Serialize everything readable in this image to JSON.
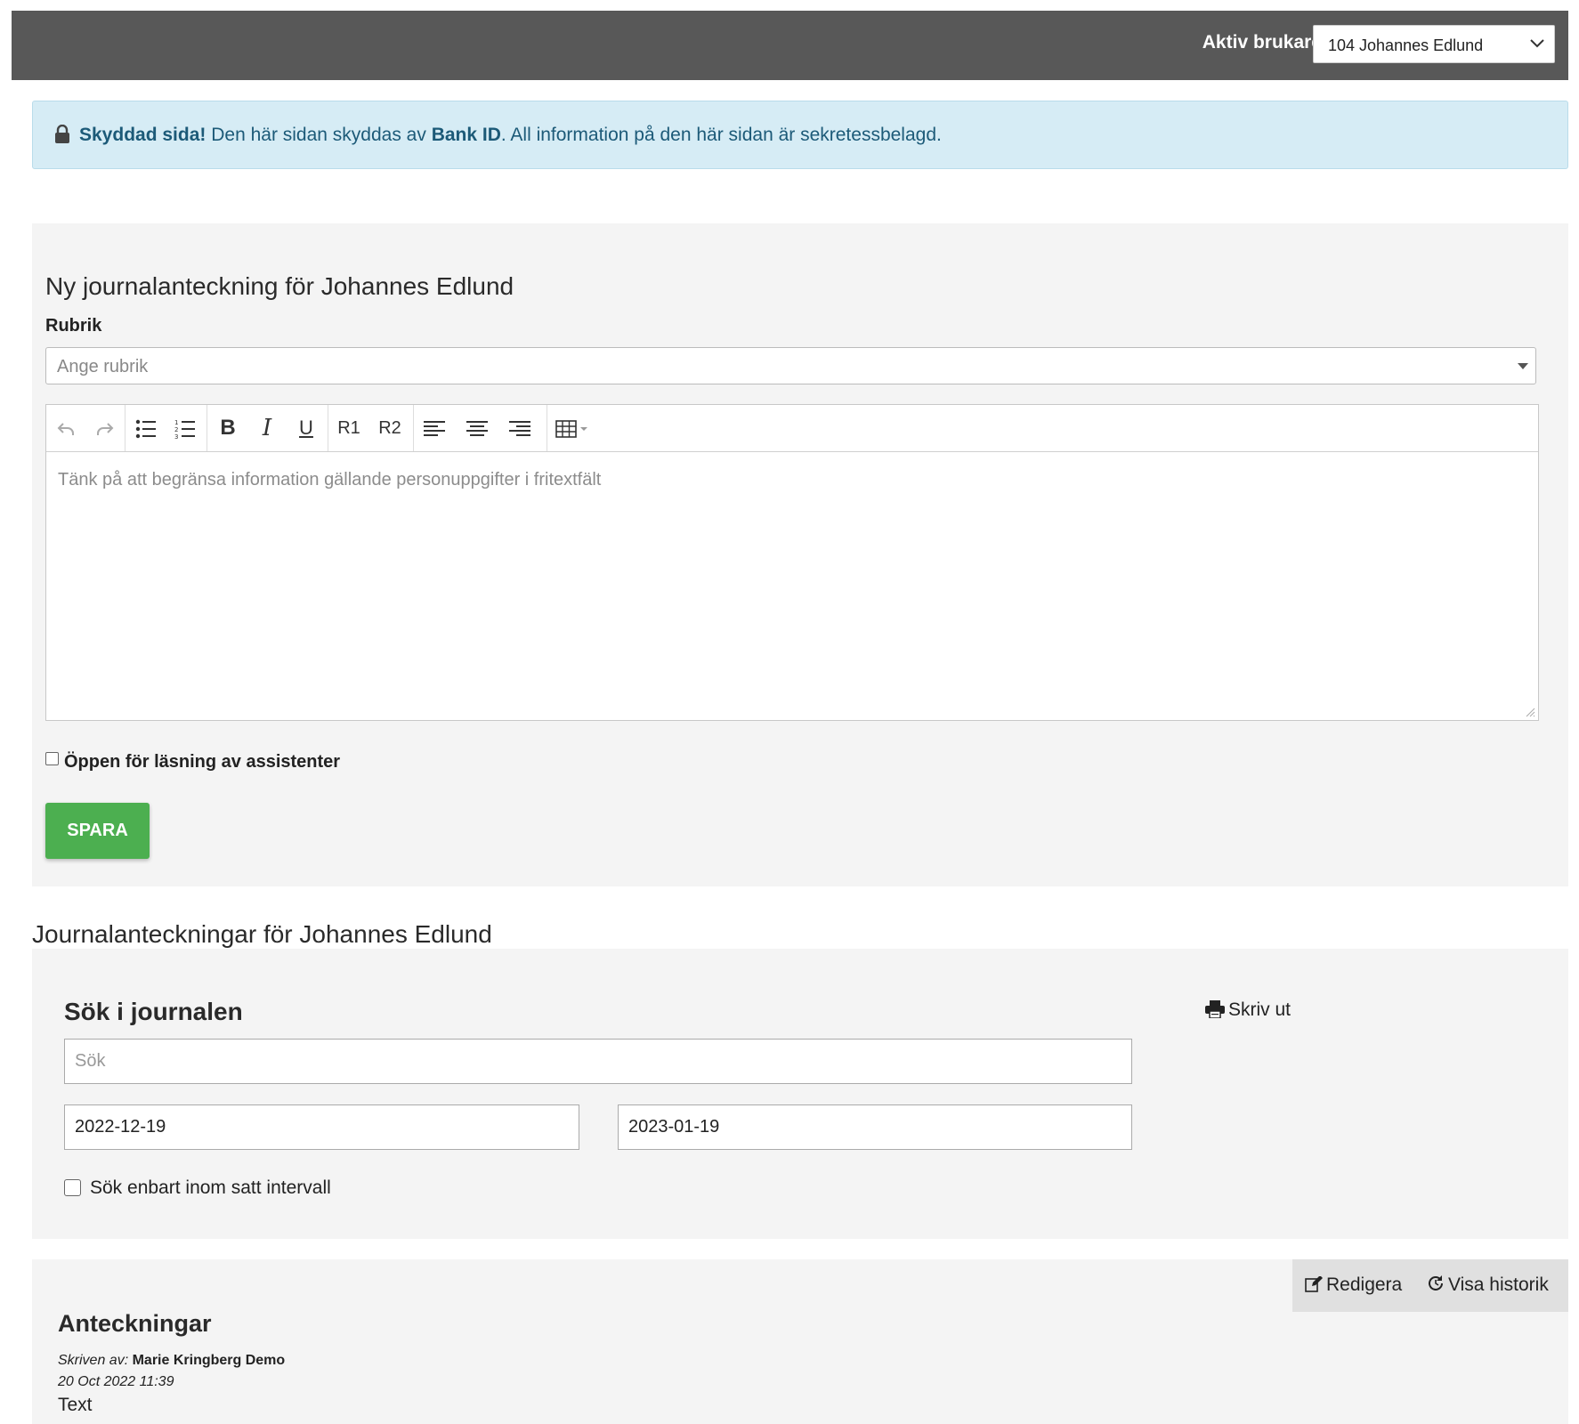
{
  "topbar": {
    "active_user_label": "Aktiv brukare",
    "active_user_value": "104 Johannes Edlund"
  },
  "alert": {
    "strong_text": "Skyddad sida!",
    "text_part1": " Den här sidan skyddas av ",
    "bank_id": "Bank ID",
    "text_part2": ". All information på den här sidan är sekretessbelagd.",
    "bg_color": "#d6ecf5",
    "text_color": "#1c5a78"
  },
  "new_note": {
    "title": "Ny journalanteckning för Johannes Edlund",
    "rubrik_label": "Rubrik",
    "rubrik_placeholder": "Ange rubrik",
    "editor_placeholder": "Tänk på att begränsa information gällande personuppgifter i fritextfält",
    "toolbar": {
      "undo": "undo-icon",
      "redo": "redo-icon",
      "bullet_list": "bullet-list-icon",
      "numbered_list": "numbered-list-icon",
      "bold": "B",
      "italic": "I",
      "underline": "U",
      "heading1": "R1",
      "heading2": "R2",
      "align_left": "align-left-icon",
      "align_center": "align-center-icon",
      "align_right": "align-right-icon",
      "table": "table-icon"
    },
    "assistants_checkbox_label": "Öppen för läsning av assistenter",
    "assistants_checked": false,
    "save_label": "SPARA",
    "save_color": "#4caf50"
  },
  "journal": {
    "title": "Journalanteckningar för Johannes Edlund",
    "search_title": "Sök i journalen",
    "print_label": "Skriv ut",
    "search_placeholder": "Sök",
    "date_from": "2022-12-19",
    "date_to": "2023-01-19",
    "interval_checkbox_label": "Sök enbart inom satt intervall",
    "interval_checked": false
  },
  "notes": {
    "title": "Anteckningar",
    "edit_label": "Redigera",
    "history_label": "Visa historik",
    "written_by_label": "Skriven av:",
    "author": "Marie Kringberg Demo",
    "date": "20 Oct 2022 11:39",
    "text": "Text"
  }
}
